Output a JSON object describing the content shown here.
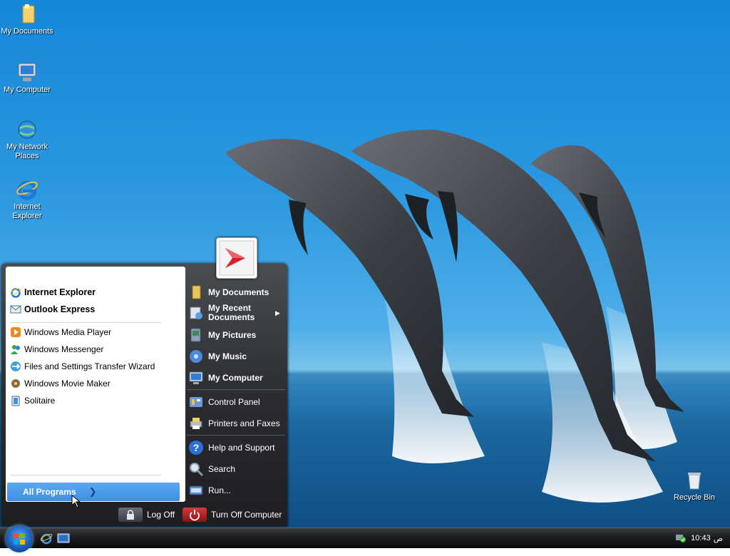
{
  "desktop": {
    "icons": [
      {
        "label": "My Documents",
        "icon": "folder-icon"
      },
      {
        "label": "My Computer",
        "icon": "computer-icon"
      },
      {
        "label": "My Network Places",
        "icon": "network-icon"
      },
      {
        "label": "Internet Explorer",
        "icon": "ie-icon"
      },
      {
        "label": "Recycle Bin",
        "icon": "recycle-bin-icon"
      }
    ]
  },
  "start_menu": {
    "pinned": [
      {
        "label": "Internet Explorer",
        "icon": "ie-icon"
      },
      {
        "label": "Outlook Express",
        "icon": "outlook-icon"
      }
    ],
    "recent": [
      {
        "label": "Windows Media Player",
        "icon": "media-player-icon"
      },
      {
        "label": "Windows Messenger",
        "icon": "messenger-icon"
      },
      {
        "label": "Files and Settings Transfer Wizard",
        "icon": "transfer-wizard-icon"
      },
      {
        "label": "Windows Movie Maker",
        "icon": "movie-maker-icon"
      },
      {
        "label": "Solitaire",
        "icon": "solitaire-icon"
      }
    ],
    "all_programs": "All Programs",
    "places": [
      {
        "label": "My Documents",
        "icon": "folder-icon"
      },
      {
        "label": "My Recent Documents",
        "icon": "recent-docs-icon"
      },
      {
        "label": "My Pictures",
        "icon": "pictures-icon"
      },
      {
        "label": "My Music",
        "icon": "music-icon"
      },
      {
        "label": "My Computer",
        "icon": "computer-icon"
      }
    ],
    "settings": [
      {
        "label": "Control Panel",
        "icon": "control-panel-icon"
      },
      {
        "label": "Printers and Faxes",
        "icon": "printer-icon"
      }
    ],
    "tools": [
      {
        "label": "Help and Support",
        "icon": "help-icon"
      },
      {
        "label": "Search",
        "icon": "search-icon"
      },
      {
        "label": "Run...",
        "icon": "run-icon"
      }
    ],
    "log_off": "Log Off",
    "turn_off": "Turn Off Computer"
  },
  "taskbar": {
    "clock": "10:43",
    "clock_period": "ص"
  },
  "colors": {
    "menu_dark": "#2b2d31",
    "all_programs_highlight": "#4a98e8",
    "taskbar": "#1b1c1f"
  }
}
